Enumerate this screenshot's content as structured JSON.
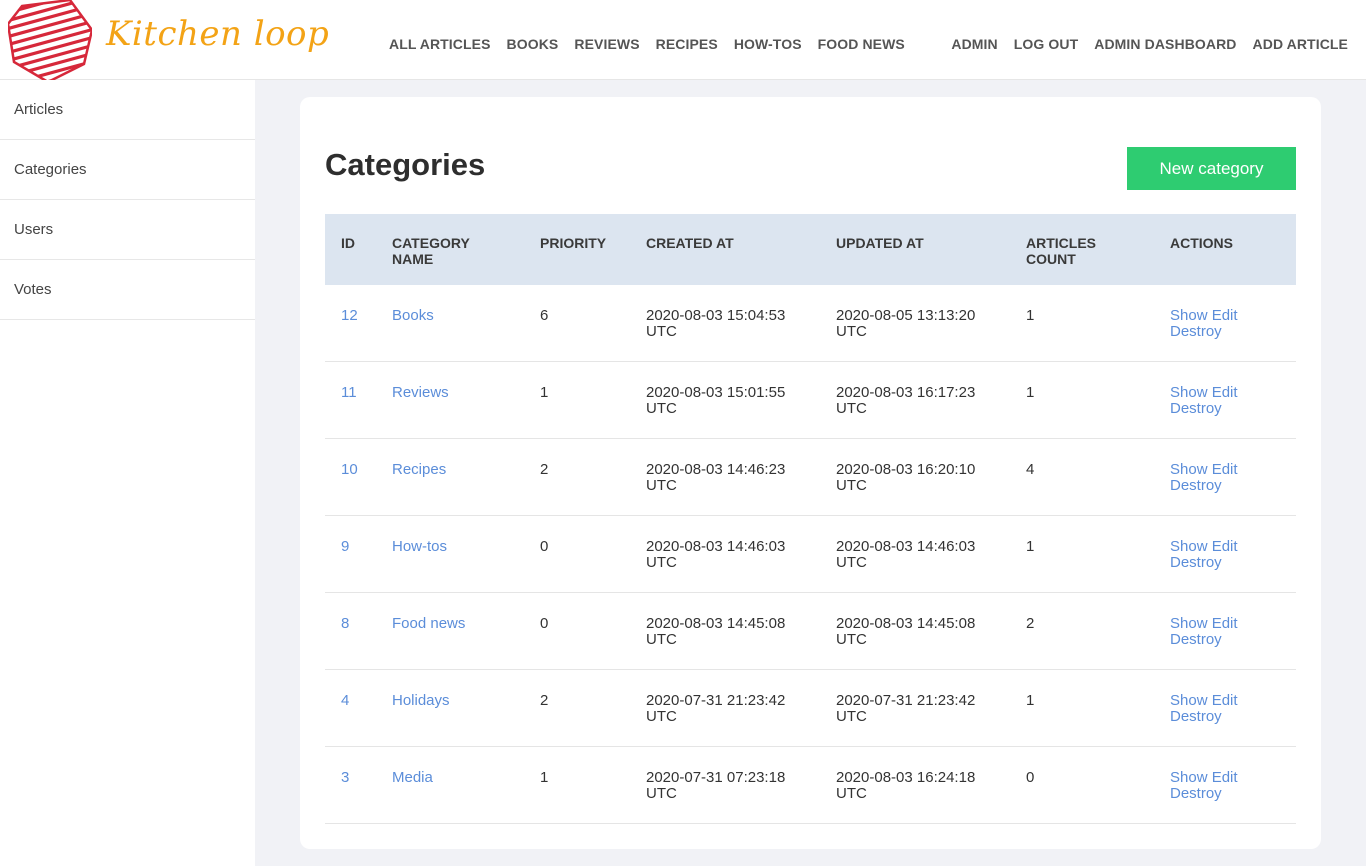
{
  "brand": {
    "name": "Kitchen loop"
  },
  "nav": {
    "main": [
      "ALL ARTICLES",
      "BOOKS",
      "REVIEWS",
      "RECIPES",
      "HOW-TOS",
      "FOOD NEWS"
    ],
    "right": [
      "ADMIN",
      "LOG OUT",
      "ADMIN DASHBOARD",
      "ADD ARTICLE"
    ]
  },
  "sidebar": {
    "items": [
      "Articles",
      "Categories",
      "Users",
      "Votes"
    ]
  },
  "page": {
    "title": "Categories",
    "new_button": "New category"
  },
  "table": {
    "headers": {
      "id": "ID",
      "name_line1": "CATEGORY",
      "name_line2": "NAME",
      "priority": "PRIORITY",
      "created": "CREATED AT",
      "updated": "UPDATED AT",
      "count_line1": "ARTICLES",
      "count_line2": "COUNT",
      "actions": "ACTIONS"
    },
    "action_labels": {
      "show": "Show",
      "edit": "Edit",
      "destroy": "Destroy"
    },
    "rows": [
      {
        "id": "12",
        "name": "Books",
        "priority": "6",
        "created_date": "2020-08-03 15:04:53",
        "created_tz": "UTC",
        "updated_date": "2020-08-05 13:13:20",
        "updated_tz": "UTC",
        "count": "1"
      },
      {
        "id": "11",
        "name": "Reviews",
        "priority": "1",
        "created_date": "2020-08-03 15:01:55",
        "created_tz": "UTC",
        "updated_date": "2020-08-03 16:17:23",
        "updated_tz": "UTC",
        "count": "1"
      },
      {
        "id": "10",
        "name": "Recipes",
        "priority": "2",
        "created_date": "2020-08-03 14:46:23",
        "created_tz": "UTC",
        "updated_date": "2020-08-03 16:20:10",
        "updated_tz": "UTC",
        "count": "4"
      },
      {
        "id": "9",
        "name": "How-tos",
        "priority": "0",
        "created_date": "2020-08-03 14:46:03",
        "created_tz": "UTC",
        "updated_date": "2020-08-03 14:46:03",
        "updated_tz": "UTC",
        "count": "1"
      },
      {
        "id": "8",
        "name": "Food news",
        "priority": "0",
        "created_date": "2020-08-03 14:45:08",
        "created_tz": "UTC",
        "updated_date": "2020-08-03 14:45:08",
        "updated_tz": "UTC",
        "count": "2"
      },
      {
        "id": "4",
        "name": "Holidays",
        "priority": "2",
        "created_date": "2020-07-31 21:23:42",
        "created_tz": "UTC",
        "updated_date": "2020-07-31 21:23:42",
        "updated_tz": "UTC",
        "count": "1"
      },
      {
        "id": "3",
        "name": "Media",
        "priority": "1",
        "created_date": "2020-07-31 07:23:18",
        "created_tz": "UTC",
        "updated_date": "2020-08-03 16:24:18",
        "updated_tz": "UTC",
        "count": "0"
      }
    ]
  },
  "colors": {
    "brand_red": "#d6283a",
    "brand_orange": "#f3a316",
    "accent_green": "#2ecc71",
    "link_blue": "#5b8dd9",
    "table_header_bg": "#dce5f0"
  }
}
